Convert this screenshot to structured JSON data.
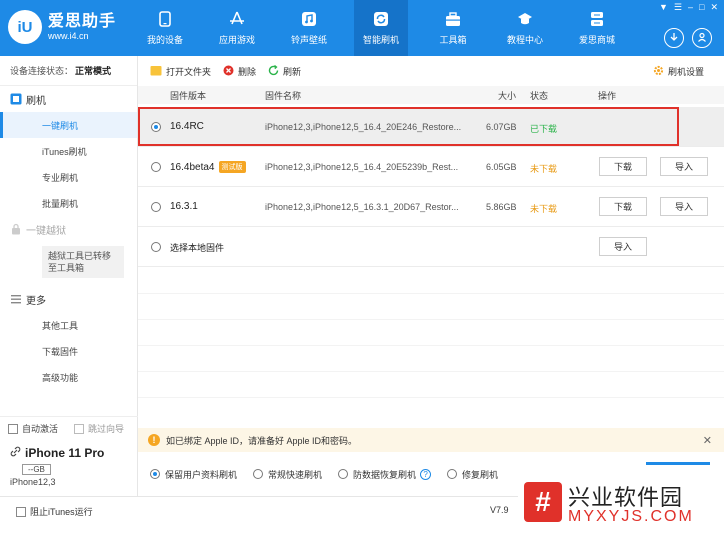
{
  "app": {
    "logo_short": "iU",
    "name": "爱思助手",
    "url": "www.i4.cn"
  },
  "nav": [
    {
      "label": "我的设备",
      "icon": "phone-icon"
    },
    {
      "label": "应用游戏",
      "icon": "apps-icon"
    },
    {
      "label": "铃声壁纸",
      "icon": "music-icon"
    },
    {
      "label": "智能刷机",
      "icon": "flash-icon",
      "active": true
    },
    {
      "label": "工具箱",
      "icon": "toolbox-icon"
    },
    {
      "label": "教程中心",
      "icon": "graduation-icon"
    },
    {
      "label": "爱思商城",
      "icon": "shop-icon"
    }
  ],
  "window_controls": [
    "▼",
    "☰",
    "–",
    "□",
    "✕"
  ],
  "sidebar": {
    "status_label": "设备连接状态：",
    "status_value": "正常模式",
    "group_flash": "刷机",
    "items_flash": [
      "一键刷机",
      "iTunes刷机",
      "专业刷机",
      "批量刷机"
    ],
    "group_jailbreak": "一键越狱",
    "jailbreak_note": "越狱工具已转移至工具箱",
    "group_more": "更多",
    "items_more": [
      "其他工具",
      "下载固件",
      "高级功能"
    ],
    "auto_activate": "自动激活",
    "skip_wizard": "跳过向导"
  },
  "device": {
    "name": "iPhone 11 Pro",
    "capacity": "--GB",
    "model": "iPhone12,3"
  },
  "toolbar": {
    "open_folder": "打开文件夹",
    "delete": "删除",
    "refresh": "刷新",
    "settings": "刷机设置"
  },
  "table": {
    "headers": {
      "version": "固件版本",
      "name": "固件名称",
      "size": "大小",
      "status": "状态",
      "action": "操作"
    },
    "rows": [
      {
        "version": "16.4RC",
        "tag": "",
        "name": "iPhone12,3,iPhone12,5_16.4_20E246_Restore...",
        "size": "6.07GB",
        "status": "已下载",
        "status_kind": "done",
        "download": "",
        "import": "",
        "selected": true
      },
      {
        "version": "16.4beta4",
        "tag": "测试版",
        "name": "iPhone12,3,iPhone12,5_16.4_20E5239b_Rest...",
        "size": "6.05GB",
        "status": "未下载",
        "status_kind": "pending",
        "download": "下载",
        "import": "导入",
        "selected": false
      },
      {
        "version": "16.3.1",
        "tag": "",
        "name": "iPhone12,3,iPhone12,5_16.3.1_20D67_Restor...",
        "size": "5.86GB",
        "status": "未下载",
        "status_kind": "pending",
        "download": "下载",
        "import": "导入",
        "selected": false
      }
    ],
    "local": {
      "label": "选择本地固件",
      "import": "导入"
    }
  },
  "notice": {
    "text": "如已绑定 Apple ID，请准备好 Apple ID和密码。",
    "close": "✕"
  },
  "modes": [
    {
      "label": "保留用户资料刷机",
      "checked": true,
      "help": false
    },
    {
      "label": "常规快速刷机",
      "checked": false,
      "help": false
    },
    {
      "label": "防数据恢复刷机",
      "checked": false,
      "help": true
    },
    {
      "label": "修复刷机",
      "checked": false,
      "help": false
    }
  ],
  "footer": {
    "block_itunes": "阻止iTunes运行",
    "version": "V7.9"
  },
  "watermark": {
    "cn": "兴业软件园",
    "en": "MYXYJS.COM"
  },
  "colors": {
    "brand": "#1e8ae6",
    "done": "#2bb34a",
    "pending": "#e89a14",
    "highlight": "#e0312a"
  }
}
